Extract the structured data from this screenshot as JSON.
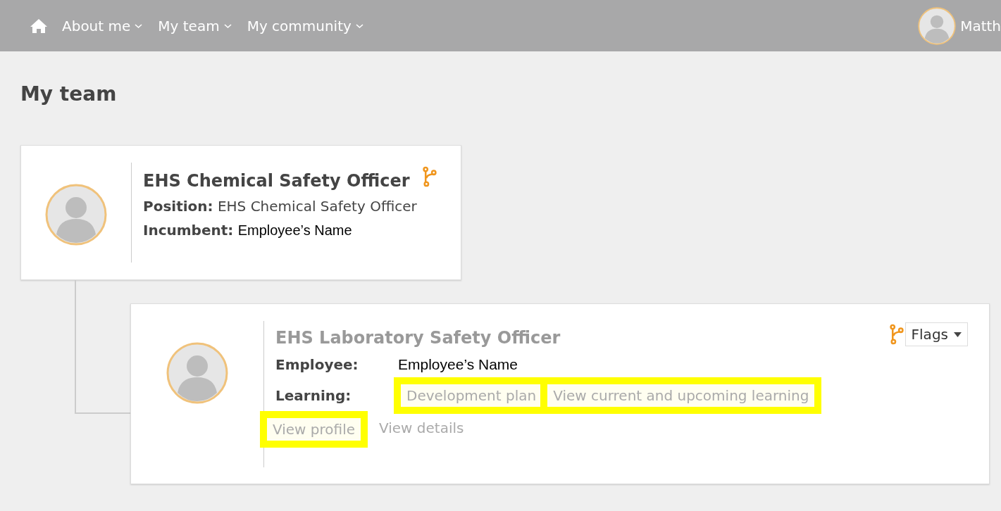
{
  "nav": {
    "items": [
      {
        "label": "About me"
      },
      {
        "label": "My team"
      },
      {
        "label": "My community"
      }
    ],
    "user_name": "Matth"
  },
  "page_title": "My team",
  "manager_card": {
    "title": "EHS Chemical Safety Officer",
    "fields": [
      {
        "label": "Position:",
        "value": "EHS Chemical Safety Officer"
      },
      {
        "label": "Incumbent:",
        "value": "Employee’s Name"
      }
    ]
  },
  "report_card": {
    "title": "EHS Laboratory Safety Officer",
    "flags_button": "Flags",
    "employee_label": "Employee:",
    "employee_value": "Employee’s Name",
    "learning_label": "Learning:",
    "learning_links": [
      {
        "label": "Development plan",
        "highlighted": true
      },
      {
        "label": "View current and upcoming learning",
        "highlighted": true
      }
    ],
    "links": [
      {
        "label": "View profile",
        "highlighted": true
      },
      {
        "label": "View details",
        "highlighted": false
      }
    ]
  }
}
